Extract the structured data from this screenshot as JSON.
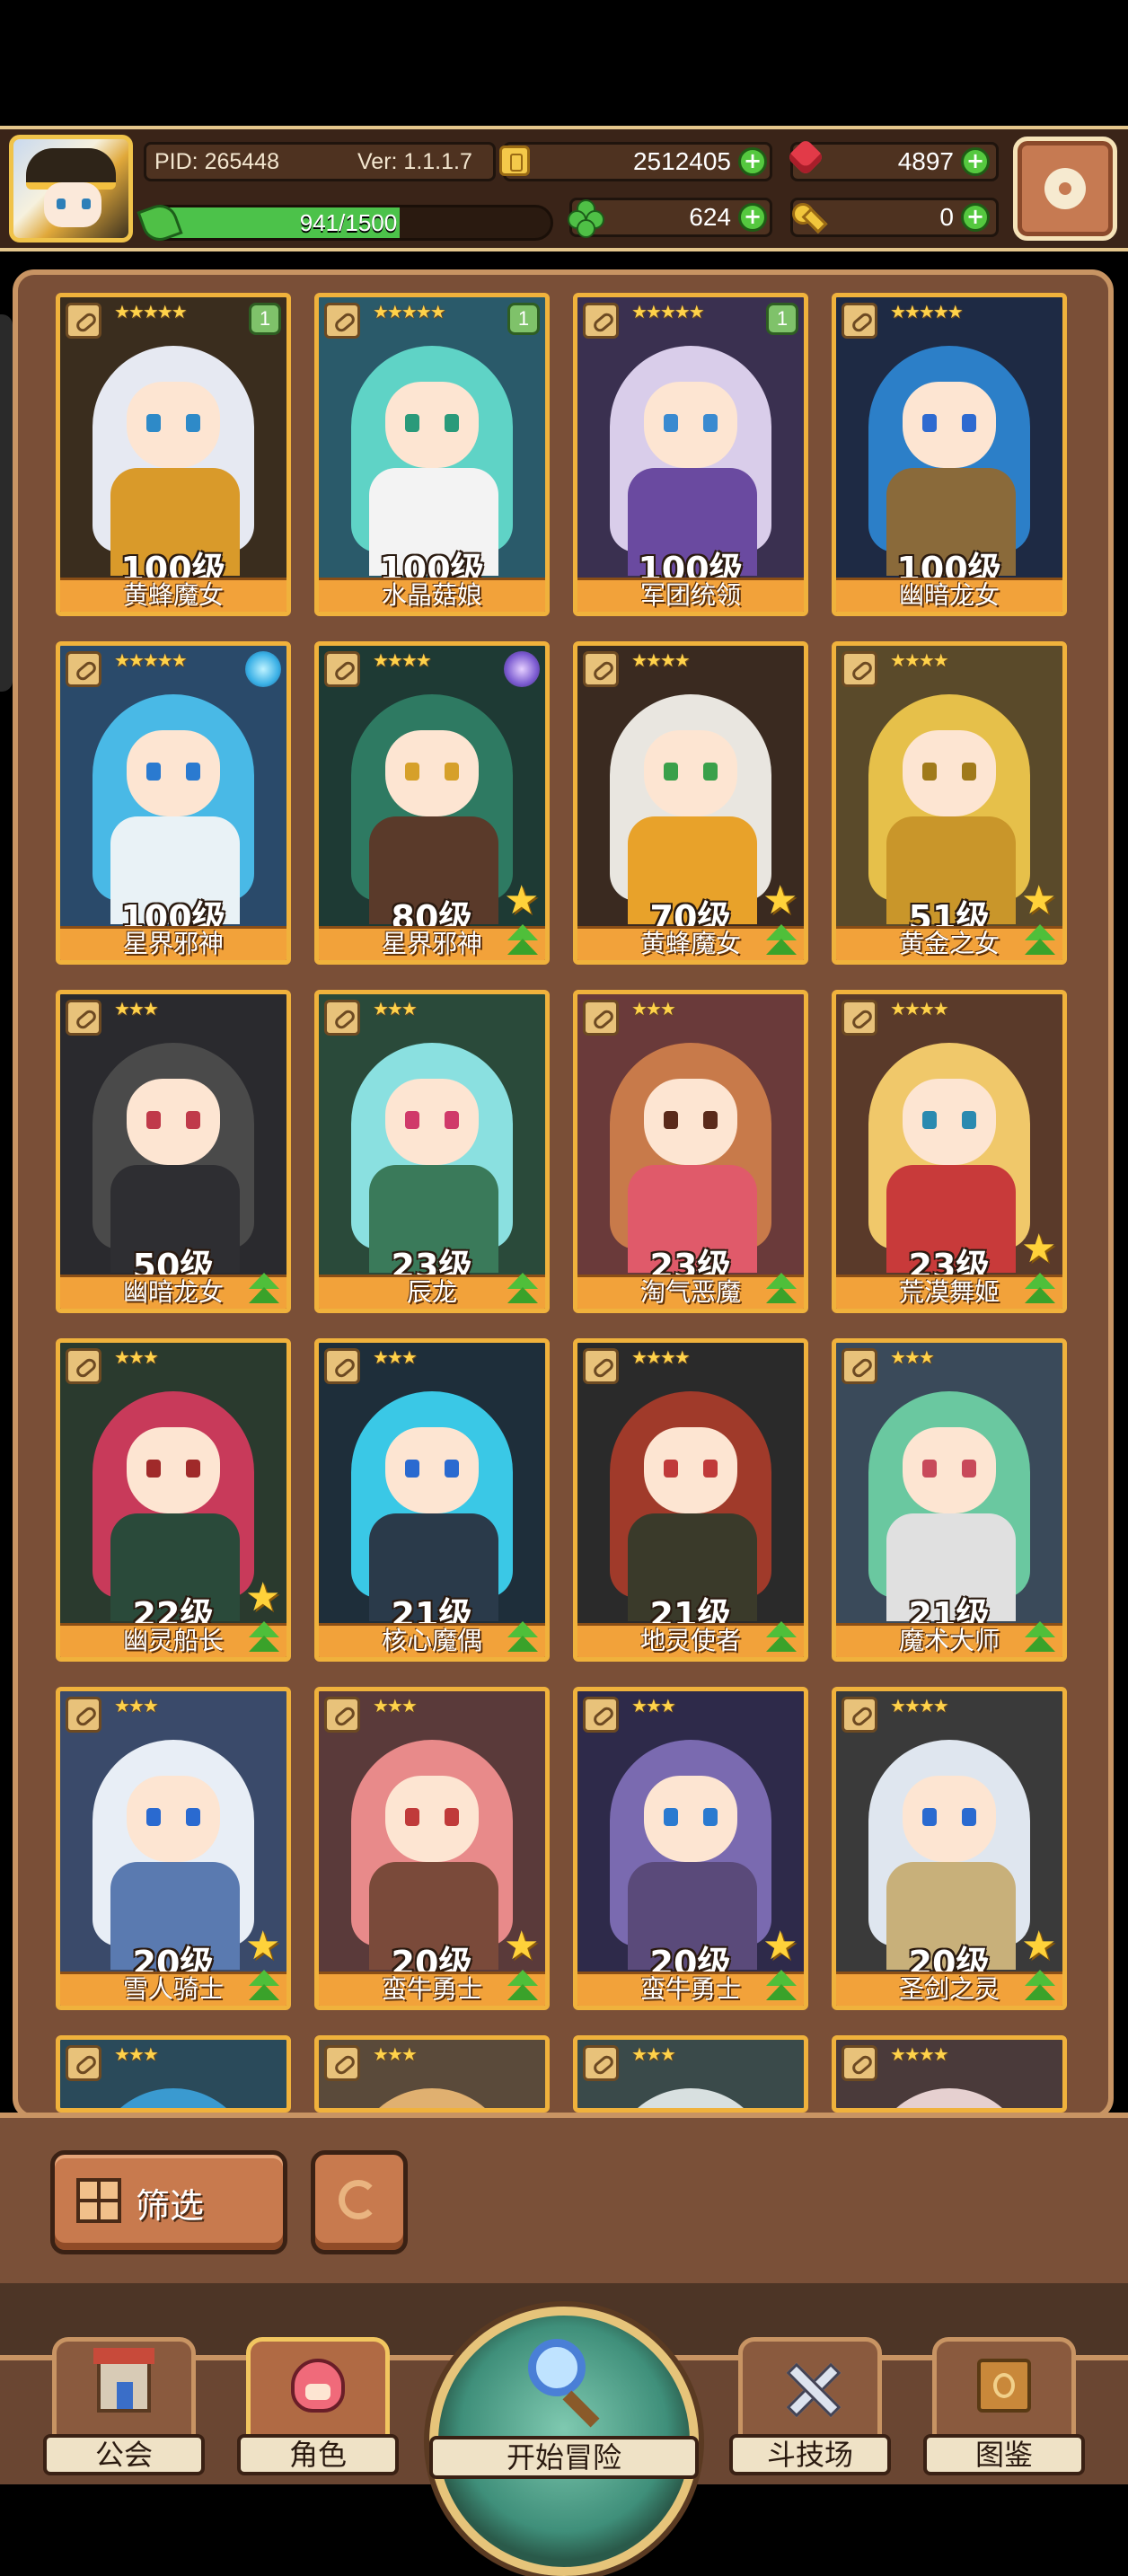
{
  "hud": {
    "pid": "PID: 265448",
    "version": "Ver: 1.1.1.7",
    "gold": "2512405",
    "gems": "4897",
    "clover": "624",
    "keys": "0",
    "xp_text": "941/1500",
    "xp_current": 941,
    "xp_max": 1500
  },
  "cards": [
    {
      "level": "100级",
      "name": "黄蜂魔女",
      "stars": "★★★★★",
      "badge": "1",
      "palette": {
        "bg": "#3a2d1e",
        "hair": "#e6e9f2",
        "body": "#d99a2a",
        "eye": "#2e8ac8"
      }
    },
    {
      "level": "100级",
      "name": "水晶菇娘",
      "stars": "★★★★★",
      "badge": "1",
      "palette": {
        "bg": "#2a5a6a",
        "hair": "#5fd3c6",
        "body": "#f3f3f3",
        "eye": "#2a9a7a"
      }
    },
    {
      "level": "100级",
      "name": "军团统领",
      "stars": "★★★★★",
      "badge": "1",
      "palette": {
        "bg": "#3a3050",
        "hair": "#d9cdea",
        "body": "#6a4aa0",
        "eye": "#3a8ad0"
      }
    },
    {
      "level": "100级",
      "name": "幽暗龙女",
      "stars": "★★★★★",
      "badge": "",
      "palette": {
        "bg": "#1e2a44",
        "hair": "#2c7fc8",
        "body": "#8a6a3a",
        "eye": "#2e6ad0"
      }
    },
    {
      "level": "100级",
      "name": "星界邪神",
      "stars": "★★★★★",
      "badge": "",
      "palette": {
        "bg": "#2a4a6a",
        "hair": "#49b9e6",
        "body": "#e9f2f6",
        "eye": "#2a7ad0"
      }
    },
    {
      "level": "80级",
      "name": "星界邪神",
      "stars": "★★★★",
      "badge": "",
      "palette": {
        "bg": "#1e3a34",
        "hair": "#2e7a62",
        "body": "#5a3a2a",
        "eye": "#d6a02a"
      }
    },
    {
      "level": "70级",
      "name": "黄蜂魔女",
      "stars": "★★★★",
      "badge": "",
      "palette": {
        "bg": "#3a2a20",
        "hair": "#e9e6e0",
        "body": "#e8a22a",
        "eye": "#3aa04a"
      }
    },
    {
      "level": "51级",
      "name": "黄金之女",
      "stars": "★★★★",
      "badge": "",
      "palette": {
        "bg": "#5a4a2a",
        "hair": "#e6c04a",
        "body": "#c9962a",
        "eye": "#a07a1a"
      }
    },
    {
      "level": "50级",
      "name": "幽暗龙女",
      "stars": "★★★",
      "badge": "",
      "palette": {
        "bg": "#2a2a2e",
        "hair": "#4a4a4a",
        "body": "#2e2e32",
        "eye": "#c03a4a"
      }
    },
    {
      "level": "23级",
      "name": "辰龙",
      "stars": "★★★",
      "badge": "",
      "palette": {
        "bg": "#2a4a3a",
        "hair": "#8ae0e0",
        "body": "#3a7a5a",
        "eye": "#d03a6a"
      }
    },
    {
      "level": "23级",
      "name": "淘气恶魔",
      "stars": "★★★",
      "badge": "",
      "palette": {
        "bg": "#6a3a3a",
        "hair": "#c87a4a",
        "body": "#e05a6a",
        "eye": "#5a2a1a"
      }
    },
    {
      "level": "23级",
      "name": "荒漠舞姬",
      "stars": "★★★★",
      "badge": "",
      "palette": {
        "bg": "#5a3a2a",
        "hair": "#f0c86a",
        "body": "#c83a3a",
        "eye": "#2a8ab0"
      }
    },
    {
      "level": "22级",
      "name": "幽灵船长",
      "stars": "★★★",
      "badge": "",
      "palette": {
        "bg": "#2a3a2e",
        "hair": "#c83a5a",
        "body": "#2a4a3a",
        "eye": "#a02a2a"
      }
    },
    {
      "level": "21级",
      "name": "核心魔偶",
      "stars": "★★★",
      "badge": "",
      "palette": {
        "bg": "#1e2e3a",
        "hair": "#3ac8e6",
        "body": "#2a3a4a",
        "eye": "#2a6ad0"
      }
    },
    {
      "level": "21级",
      "name": "地灵使者",
      "stars": "★★★★",
      "badge": "",
      "palette": {
        "bg": "#2a2a2a",
        "hair": "#a03a2a",
        "body": "#3a3a2a",
        "eye": "#c03a3a"
      }
    },
    {
      "level": "21级",
      "name": "魔术大师",
      "stars": "★★★",
      "badge": "",
      "palette": {
        "bg": "#3a4a5a",
        "hair": "#6ac8a0",
        "body": "#e0e0e0",
        "eye": "#c84a5a"
      }
    },
    {
      "level": "20级",
      "name": "雪人骑士",
      "stars": "★★★",
      "badge": "",
      "palette": {
        "bg": "#3a4a6a",
        "hair": "#e8eef6",
        "body": "#5a7ab0",
        "eye": "#2a6ad0"
      }
    },
    {
      "level": "20级",
      "name": "蛮牛勇士",
      "stars": "★★★",
      "badge": "",
      "palette": {
        "bg": "#5a3a3a",
        "hair": "#e88a8a",
        "body": "#7a4a3a",
        "eye": "#c03a3a"
      }
    },
    {
      "level": "20级",
      "name": "蛮牛勇士",
      "stars": "★★★",
      "badge": "",
      "palette": {
        "bg": "#2e2a4a",
        "hair": "#7a6ab0",
        "body": "#5a4a7a",
        "eye": "#2a7ad0"
      }
    },
    {
      "level": "20级",
      "name": "圣剑之灵",
      "stars": "★★★★",
      "badge": "",
      "palette": {
        "bg": "#3a3a3a",
        "hair": "#dfe6ef",
        "body": "#c8b07a",
        "eye": "#2a6ad0"
      }
    },
    {
      "level": "",
      "name": "",
      "stars": "★★★",
      "badge": "",
      "palette": {
        "bg": "#2a4a5a",
        "hair": "#3a9ad0",
        "body": "#2a4a5a",
        "eye": "#2a6ad0"
      }
    },
    {
      "level": "",
      "name": "",
      "stars": "★★★",
      "badge": "",
      "palette": {
        "bg": "#5a4a3a",
        "hair": "#e0b070",
        "body": "#5a4a3a",
        "eye": "#2a6ad0"
      }
    },
    {
      "level": "",
      "name": "",
      "stars": "★★★",
      "badge": "",
      "palette": {
        "bg": "#3a4a4a",
        "hair": "#d8e0e0",
        "body": "#3a4a4a",
        "eye": "#2a6ad0"
      }
    },
    {
      "level": "",
      "name": "",
      "stars": "★★★★",
      "badge": "",
      "palette": {
        "bg": "#4a3a3a",
        "hair": "#e6d0d0",
        "body": "#4a3a3a",
        "eye": "#2a6ad0"
      }
    }
  ],
  "filter": {
    "label": "筛选"
  },
  "nav": {
    "guild": "公会",
    "role": "角色",
    "adventure": "开始冒险",
    "arena": "斗技场",
    "codex": "图鉴"
  },
  "colors": {
    "frame_gold": "#f0b23c",
    "panel_brown": "#7a4f37",
    "xp_green": "#4cc24a"
  }
}
